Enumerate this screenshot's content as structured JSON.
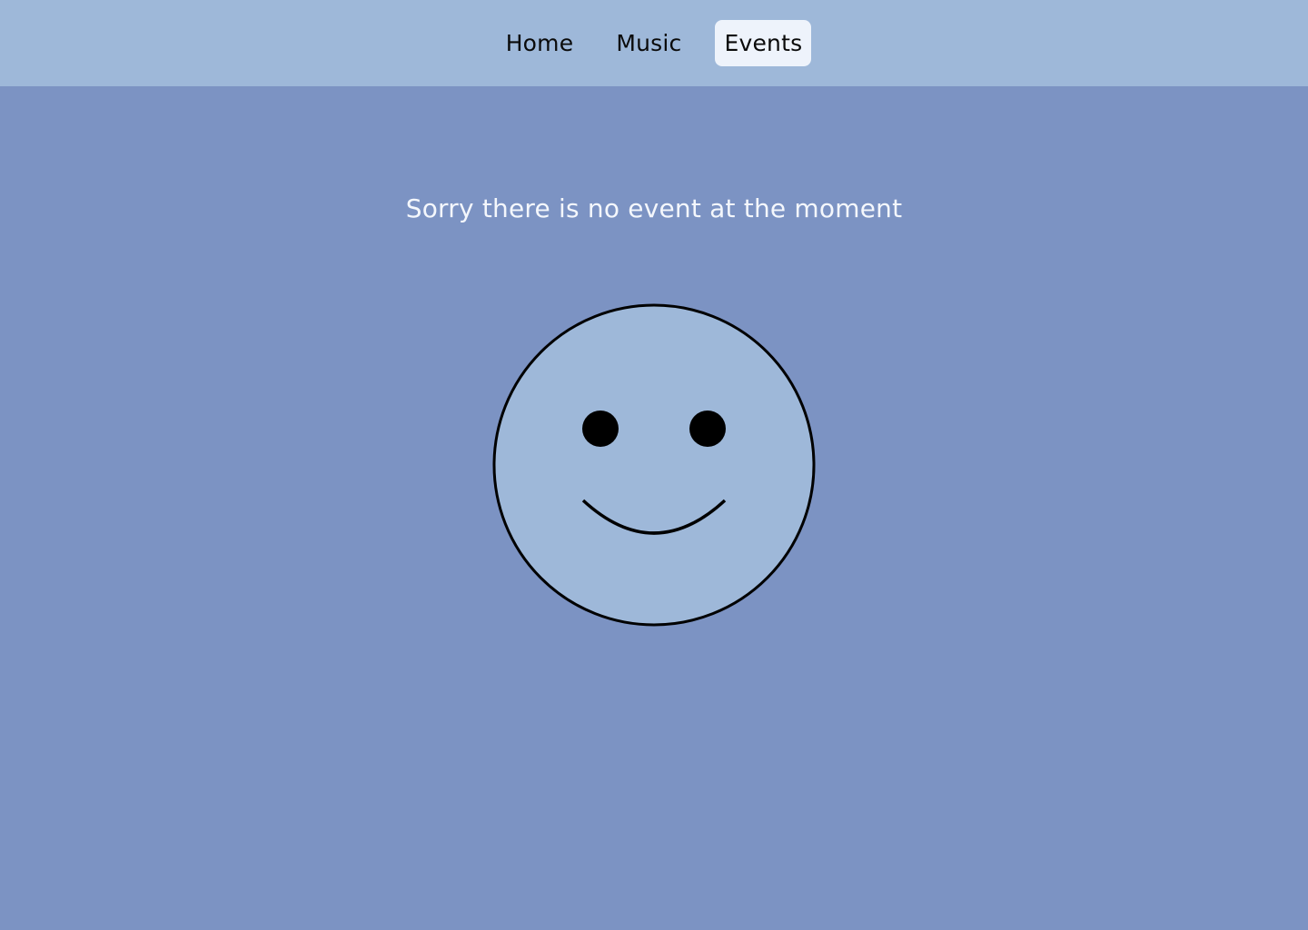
{
  "nav": {
    "items": [
      {
        "label": "Home",
        "active": false
      },
      {
        "label": "Music",
        "active": false
      },
      {
        "label": "Events",
        "active": true
      }
    ]
  },
  "main": {
    "message": "Sorry there is no event at the moment",
    "illustration_icon": "smiley-face-icon"
  },
  "colors": {
    "page_background": "#7c93c3",
    "header_background": "#9eb8d9",
    "active_tab_background": "#eef3fb",
    "face_fill": "#9eb8d9",
    "message_text": "#f4f7fc"
  }
}
